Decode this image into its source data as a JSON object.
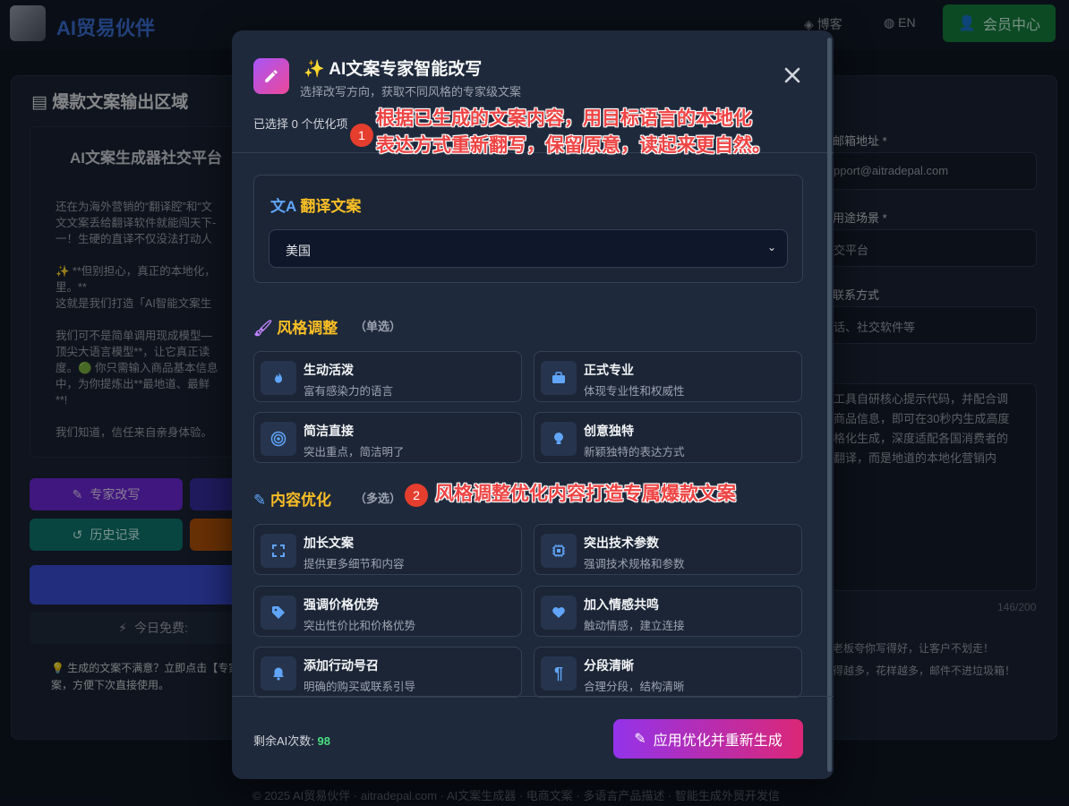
{
  "header": {
    "brand": "AI贸易伙伴",
    "blog": "博客",
    "lang": "EN",
    "member": "会员中心"
  },
  "left": {
    "title": "爆款文案输出区域",
    "card_title": "AI文案生成器社交平台",
    "text": "还在为海外营销的“翻译腔”和“文\n文文案丢给翻译软件就能闯天下-\n一！生硬的直译不仅没法打动人\n\n✨ **但别担心，真正的本地化，\n里。**\n这就是我们打造「AI智能文案生\n\n我们可不是简单调用现成模型—\n顶尖大语言模型**，让它真正读\n度。🟢 你只需输入商品基本信息\n中，为你提炼出**最地道、最鲜\n**!\n\n我们知道，信任来自亲身体验。",
    "btn_rewrite": "专家改写",
    "btn_history": "历史记录",
    "quota": "今日免费:",
    "tip": "💡 生成的文案不满意？立即点击【专家\n案，方便下次直接使用。"
  },
  "right": {
    "email_label": "邮箱地址 *",
    "email_value": "pport@aitradepal.com",
    "scene_label": "用途场景 *",
    "scene_value": "交平台",
    "contact_label": "联系方式",
    "contact_placeholder": "话、社交软件等",
    "desc": "工具自研核心提示代码，并配合调\n商品信息，即可在30秒内生成高度\n格化生成，深度适配各国消费者的\n翻译，而是地道的本地化营销内",
    "counter": "146/200",
    "note1": "老板夸你写得好，让客户不划走！",
    "note2": "得越多，花样越多，邮件不进垃圾箱！"
  },
  "footer": "© 2025 AI贸易伙伴 · aitradepal.com · AI文案生成器 · 电商文案 · 多语言产品描述 · 智能生成外贸开发信",
  "modal": {
    "title": "✨ AI文案专家智能改写",
    "subtitle": "选择改写方向，获取不同风格的专家级文案",
    "selected": "已选择 0 个优化项",
    "translate_title": "翻译文案",
    "translate_value": "美国",
    "style_title": "风格调整",
    "style_note": "（单选）",
    "styles": [
      {
        "title": "生动活泼",
        "desc": "富有感染力的语言",
        "icon": "fire-icon"
      },
      {
        "title": "正式专业",
        "desc": "体现专业性和权威性",
        "icon": "briefcase-icon"
      },
      {
        "title": "简洁直接",
        "desc": "突出重点，简洁明了",
        "icon": "target-icon"
      },
      {
        "title": "创意独特",
        "desc": "新颖独特的表达方式",
        "icon": "lightbulb-icon"
      }
    ],
    "content_title": "内容优化",
    "content_note": "（多选）",
    "contents": [
      {
        "title": "加长文案",
        "desc": "提供更多细节和内容",
        "icon": "expand-icon"
      },
      {
        "title": "突出技术参数",
        "desc": "强调技术规格和参数",
        "icon": "chip-icon"
      },
      {
        "title": "强调价格优势",
        "desc": "突出性价比和价格优势",
        "icon": "tag-icon"
      },
      {
        "title": "加入情感共鸣",
        "desc": "触动情感，建立连接",
        "icon": "heart-icon"
      },
      {
        "title": "添加行动号召",
        "desc": "明确的购买或联系引导",
        "icon": "bell-icon"
      },
      {
        "title": "分段清晰",
        "desc": "合理分段，结构清晰",
        "icon": "paragraph-icon"
      }
    ],
    "remaining_label": "剩余AI次数:",
    "remaining_value": "98",
    "apply": "应用优化并重新生成"
  },
  "annotations": {
    "a1": "根据已生成的文案内容，用目标语言的本地化\n表达方式重新翻写，保留原意，读起来更自然。",
    "a2": "风格调整优化内容打造专属爆款文案",
    "b1": "1",
    "b2": "2"
  }
}
